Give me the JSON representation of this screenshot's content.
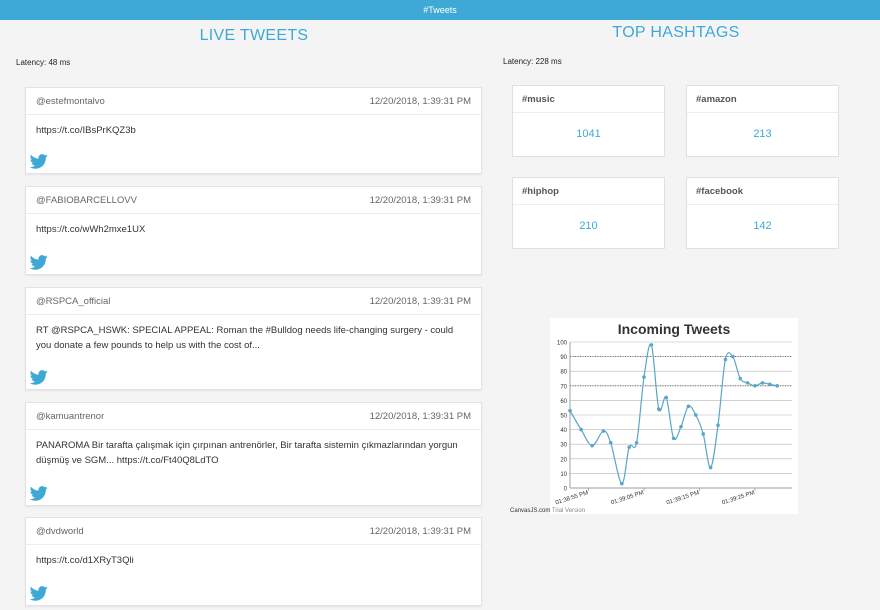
{
  "header": {
    "title": "#Tweets"
  },
  "live": {
    "title": "LIVE TWEETS",
    "latency": "Latency: 48 ms",
    "tweets": [
      {
        "user": "@estefmontalvo",
        "time": "12/20/2018, 1:39:31 PM",
        "text": "https://t.co/IBsPrKQZ3b"
      },
      {
        "user": "@FABIOBARCELLOVV",
        "time": "12/20/2018, 1:39:31 PM",
        "text": "https://t.co/wWh2mxe1UX"
      },
      {
        "user": "@RSPCA_official",
        "time": "12/20/2018, 1:39:31 PM",
        "text": "RT @RSPCA_HSWK: SPECIAL APPEAL: Roman the #Bulldog needs life-changing surgery - could you donate a few pounds to help us with the cost of..."
      },
      {
        "user": "@kamuantrenor",
        "time": "12/20/2018, 1:39:31 PM",
        "text": "PANAROMA Bir tarafta çalışmak için çırpınan antrenörler, Bir tarafta sistemin çıkmazlarından yorgun düşmüş ve SGM... https://t.co/Ft40Q8LdTO"
      },
      {
        "user": "@dvdworld",
        "time": "12/20/2018, 1:39:31 PM",
        "text": "https://t.co/d1XRyT3Qli"
      }
    ]
  },
  "hashtags": {
    "title": "TOP HASHTAGS",
    "latency": "Latency: 228 ms",
    "items": [
      {
        "tag": "#music",
        "count": "1041"
      },
      {
        "tag": "#amazon",
        "count": "213"
      },
      {
        "tag": "#hiphop",
        "count": "210"
      },
      {
        "tag": "#facebook",
        "count": "142"
      }
    ]
  },
  "colors": {
    "accent": "#3fa9d6",
    "twitter": "#3fa9d6"
  },
  "icons": {
    "tweet": "twitter-bird-icon"
  },
  "chart_credit": {
    "brand": "CanvasJS.com",
    "note": "Trial Version"
  },
  "chart_data": {
    "type": "line",
    "title": "Incoming Tweets",
    "xlabel": "",
    "ylabel": "",
    "ylim": [
      0,
      100
    ],
    "yticks": [
      0,
      10,
      20,
      30,
      40,
      50,
      60,
      70,
      80,
      90,
      100
    ],
    "xticks": [
      "01:38:55 PM",
      "01:39:05 PM",
      "01:39:15 PM",
      "01:39:25 PM"
    ],
    "xlim_seconds": [
      -5,
      55
    ],
    "xtick_seconds": [
      0,
      15,
      30,
      45
    ],
    "grid": true,
    "striplines": [
      90,
      70
    ],
    "series": [
      {
        "x_seconds": [
          -5,
          -2,
          1,
          4,
          6,
          9,
          11,
          13,
          15,
          17,
          19,
          21,
          23,
          25,
          27,
          29,
          31,
          33,
          35,
          37,
          39,
          41,
          43,
          45,
          47,
          49,
          51
        ],
        "values": [
          53,
          40,
          29,
          39,
          31,
          3,
          28,
          31,
          76,
          98,
          54,
          62,
          34,
          42,
          56,
          50,
          37,
          14,
          43,
          88,
          90,
          75,
          72,
          70,
          72,
          71,
          70
        ],
        "visible_count": 20
      }
    ]
  }
}
